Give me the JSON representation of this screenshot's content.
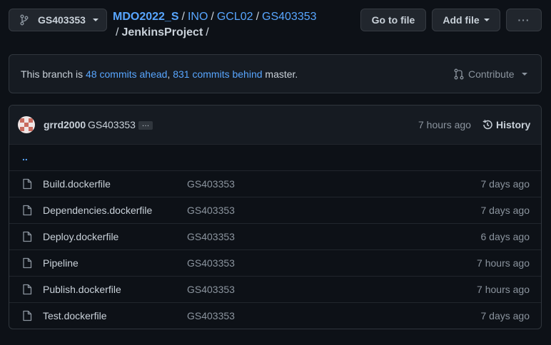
{
  "branch": {
    "name": "GS403353"
  },
  "breadcrumb": {
    "root": "MDO2022_S",
    "parts": [
      "INO",
      "GCL02",
      "GS403353"
    ],
    "current": "JenkinsProject",
    "separator": "/"
  },
  "actions": {
    "go_to_file": "Go to file",
    "add_file": "Add file",
    "more": "···"
  },
  "branch_status": {
    "prefix": "This branch is",
    "ahead": "48 commits ahead",
    "comma": ",",
    "behind": "831 commits behind",
    "suffix": "master.",
    "contribute": "Contribute"
  },
  "latest_commit": {
    "author": "grrd2000",
    "message": "GS403353",
    "ellipsis": "…",
    "time": "7 hours ago",
    "history": "History"
  },
  "parent_dir": "..",
  "files": [
    {
      "name": "Build.dockerfile",
      "message": "GS403353",
      "age": "7 days ago"
    },
    {
      "name": "Dependencies.dockerfile",
      "message": "GS403353",
      "age": "7 days ago"
    },
    {
      "name": "Deploy.dockerfile",
      "message": "GS403353",
      "age": "6 days ago"
    },
    {
      "name": "Pipeline",
      "message": "GS403353",
      "age": "7 hours ago"
    },
    {
      "name": "Publish.dockerfile",
      "message": "GS403353",
      "age": "7 hours ago"
    },
    {
      "name": "Test.dockerfile",
      "message": "GS403353",
      "age": "7 days ago"
    }
  ],
  "colors": {
    "background": "#0d1117",
    "link": "#58a6ff",
    "text": "#c9d1d9",
    "muted": "#8b949e",
    "border": "#30363d",
    "button": "#21262d"
  }
}
